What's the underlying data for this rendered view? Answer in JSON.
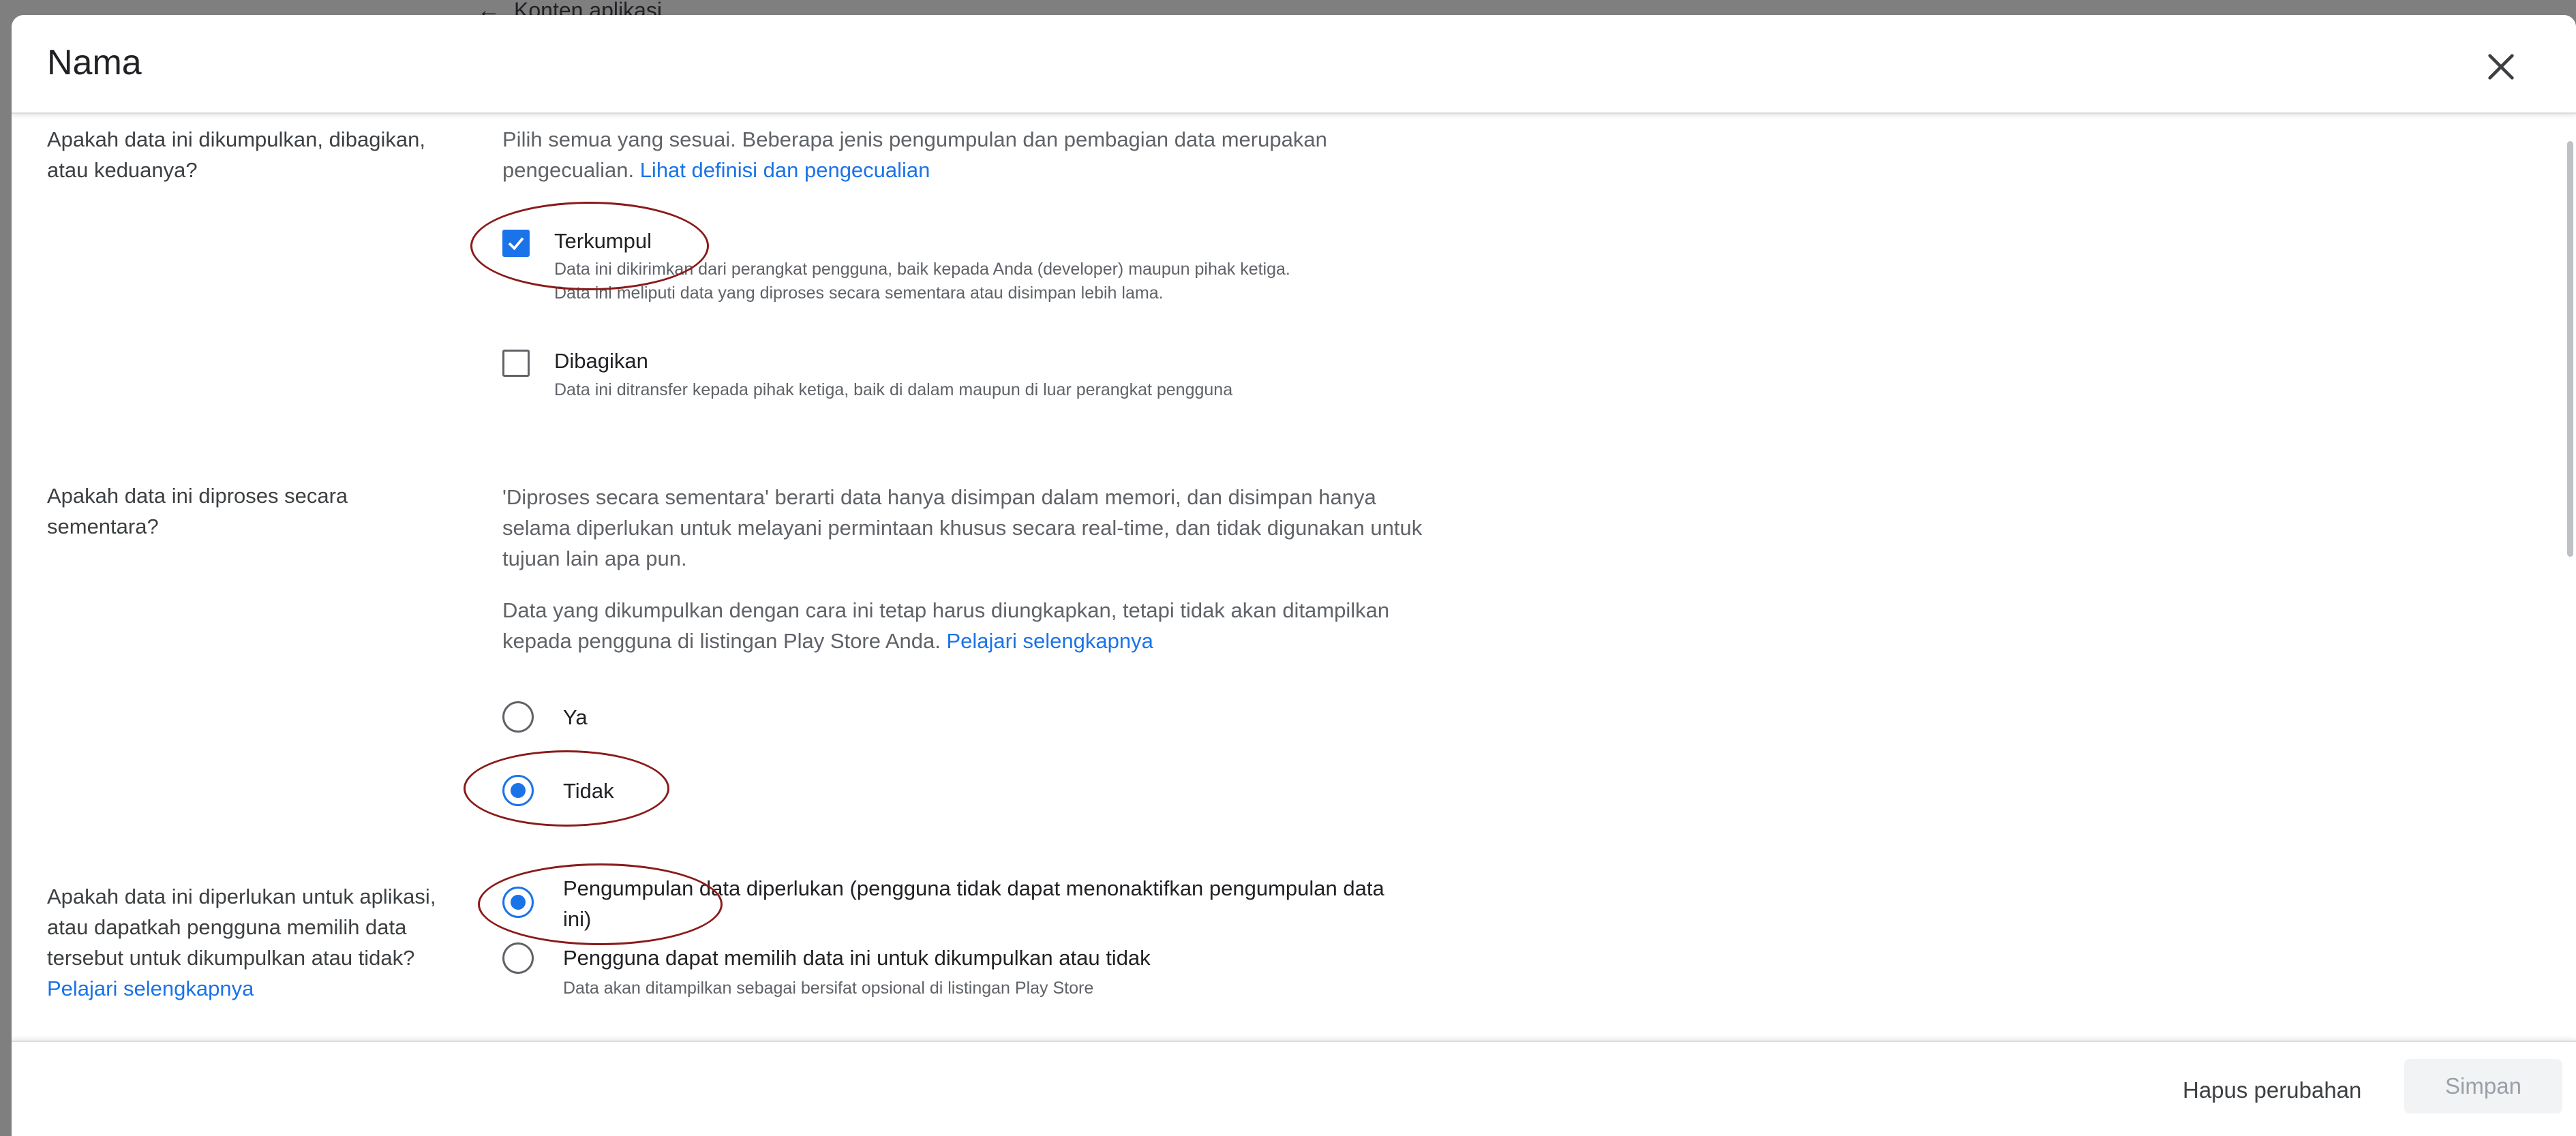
{
  "background": {
    "back_arrow_icon": "arrow-left-icon",
    "back_label": "Konten aplikasi"
  },
  "dialog": {
    "title": "Nama",
    "close_icon": "close-icon"
  },
  "q1": {
    "label": "Apakah data ini dikumpulkan, dibagikan, atau keduanya?",
    "intro": "Pilih semua yang sesuai. Beberapa jenis pengumpulan dan pembagian data merupakan pengecualian.",
    "link": "Lihat definisi dan pengecualian",
    "options": [
      {
        "title": "Terkumpul",
        "desc1": "Data ini dikirimkan dari perangkat pengguna, baik kepada Anda (developer) maupun pihak ketiga.",
        "desc2": "Data ini meliputi data yang diproses secara sementara atau disimpan lebih lama.",
        "checked": true
      },
      {
        "title": "Dibagikan",
        "desc1": "Data ini ditransfer kepada pihak ketiga, baik di dalam maupun di luar perangkat pengguna",
        "checked": false
      }
    ]
  },
  "q2": {
    "label": "Apakah data ini diproses secara sementara?",
    "para1": "'Diproses secara sementara' berarti data hanya disimpan dalam memori, dan disimpan hanya selama diperlukan untuk melayani permintaan khusus secara real-time, dan tidak digunakan untuk tujuan lain apa pun.",
    "para2": "Data yang dikumpulkan dengan cara ini tetap harus diungkapkan, tetapi tidak akan ditampilkan kepada pengguna di listingan Play Store Anda.",
    "link": "Pelajari selengkapnya",
    "options": [
      {
        "title": "Ya",
        "selected": false
      },
      {
        "title": "Tidak",
        "selected": true
      }
    ]
  },
  "q3": {
    "label": "Apakah data ini diperlukan untuk aplikasi, atau dapatkah pengguna memilih data tersebut untuk dikumpulkan atau tidak?",
    "link": "Pelajari selengkapnya",
    "options": [
      {
        "title": "Pengumpulan data diperlukan (pengguna tidak dapat menonaktifkan pengumpulan data ini)",
        "selected": true
      },
      {
        "title": "Pengguna dapat memilih data ini untuk dikumpulkan atau tidak",
        "desc": "Data akan ditampilkan sebagai bersifat opsional di listingan Play Store",
        "selected": false
      }
    ]
  },
  "footer": {
    "discard_label": "Hapus perubahan",
    "save_label": "Simpan"
  },
  "colors": {
    "accent": "#1a73e8",
    "annotation": "#8b1a1a"
  }
}
